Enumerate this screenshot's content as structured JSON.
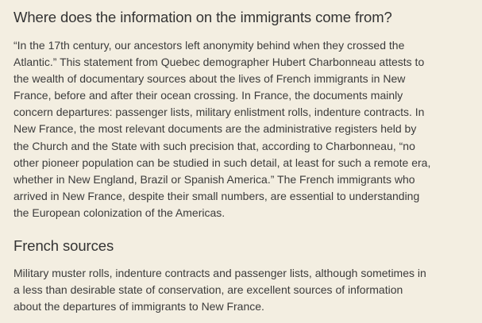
{
  "sections": [
    {
      "heading": "Where does the information on the immigrants come from?",
      "lines": [
        "“In the 17th century, our ancestors left anonymity behind when they crossed the",
        "Atlantic.” This statement from Quebec demographer Hubert Charbonneau attests to",
        "the wealth of documentary sources about the lives of French immigrants in New",
        "France, before and after their ocean crossing. In France, the documents mainly",
        "concern departures: passenger lists, military enlistment rolls, indenture contracts. In",
        "New France, the most relevant documents are the administrative registers held by",
        "the Church and the State with such precision that, according to Charbonneau, “no",
        "other pioneer population can be studied in such detail, at least for such a remote era,",
        "whether in New England, Brazil or Spanish America.” The French immigrants who",
        "arrived in New France, despite their small numbers, are essential to understanding",
        "the European colonization of the Americas."
      ]
    },
    {
      "heading": "French sources",
      "lines": [
        "Military muster rolls, indenture contracts and passenger lists, although sometimes in",
        "a less than desirable state of conservation, are excellent sources of information",
        "about the departures of immigrants to New France."
      ]
    }
  ]
}
